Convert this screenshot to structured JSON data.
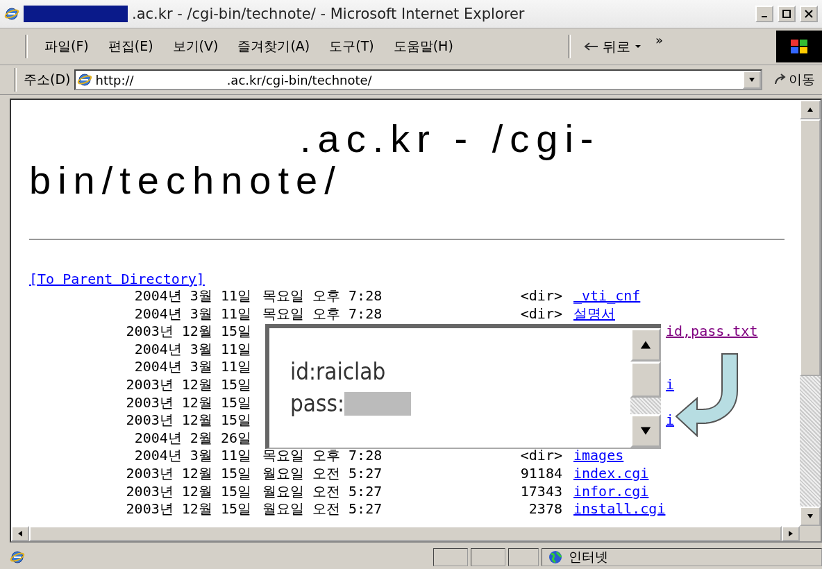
{
  "window": {
    "title": ".ac.kr - /cgi-bin/technote/ - Microsoft Internet Explorer"
  },
  "menu": [
    "파일(F)",
    "편집(E)",
    "보기(V)",
    "즐겨찾기(A)",
    "도구(T)",
    "도움말(H)"
  ],
  "toolbar": {
    "back_label": "뒤로",
    "chevron": "»"
  },
  "address_bar": {
    "label": "주소(D)",
    "url_prefix": "http://",
    "url_rest": ".ac.kr/cgi-bin/technote/",
    "go_label": "이동"
  },
  "page": {
    "heading": ".ac.kr - /cgi-bin/technote/",
    "parent_link": "[To Parent Directory]",
    "rows": [
      {
        "date": "2004년 3월 11일",
        "time": "목요일 오후 7:28",
        "size": "<dir>",
        "name": "_vti_cnf",
        "visited": false
      },
      {
        "date": "2004년 3월 11일",
        "time": "목요일 오후 7:28",
        "size": "<dir>",
        "name": "설명서",
        "visited": false
      },
      {
        "date": "2003년 12월 15일",
        "name": "id,pass.txt",
        "visited": true,
        "kind": "partial"
      },
      {
        "date": "2004년 3월 11일"
      },
      {
        "date": "2004년 3월 11일"
      },
      {
        "date": "2003년 12월 15일",
        "name": "i",
        "visited": false,
        "kind": "partial"
      },
      {
        "date": "2003년 12월 15일"
      },
      {
        "date": "2003년 12월 15일",
        "name": "i",
        "visited": false,
        "kind": "partial"
      },
      {
        "date": "2004년 2월 26일"
      },
      {
        "date": "2004년 3월 11일",
        "time": "목요일 오후 7:28",
        "size": "<dir>",
        "name": "images",
        "visited": false
      },
      {
        "date": "2003년 12월 15일",
        "time": "월요일 오전 5:27",
        "size": "91184",
        "name": "index.cgi",
        "visited": false
      },
      {
        "date": "2003년 12월 15일",
        "time": "월요일 오전 5:27",
        "size": "17343",
        "name": "infor.cgi",
        "visited": false
      },
      {
        "date": "2003년 12월 15일",
        "time": "월요일 오전 5:27",
        "size": "2378",
        "name": "install.cgi",
        "visited": false
      }
    ]
  },
  "popup": {
    "id_line": "id:raiclab",
    "pass_label": "pass:"
  },
  "status_bar": {
    "zone": "인터넷"
  }
}
